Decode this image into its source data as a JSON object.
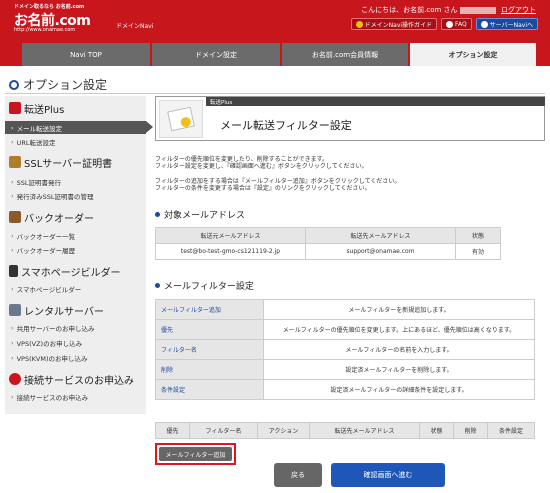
{
  "header": {
    "logo_small": "ドメイン取るなら お名前.com",
    "logo_text": "お名前.com",
    "logo_url": "http://www.onamae.com",
    "logo_navi": "ドメインNavi",
    "greeting_prefix": "こんにちは、お名前.com さん",
    "logout": "ログアウト",
    "links": [
      "ドメインNavi操作ガイド",
      "FAQ",
      "サーバーNaviへ"
    ]
  },
  "nav": {
    "tabs": [
      "Navi TOP",
      "ドメイン設定",
      "お名前.com会員情報",
      "オプション設定"
    ],
    "active_index": 3
  },
  "page_title": "オプション設定",
  "sidebar": {
    "sections": [
      {
        "title": "転送Plus",
        "icon": "arrow-icon",
        "items": [
          "メール転送設定",
          "URL転送設定"
        ]
      },
      {
        "title": "SSLサーバー証明書",
        "icon": "certificate-icon",
        "items": [
          "SSL証明書発行",
          "発行済みSSL証明書の管理"
        ]
      },
      {
        "title": "バックオーダー",
        "icon": "hammer-icon",
        "items": [
          "バックオーダー一覧",
          "バックオーダー履歴"
        ]
      },
      {
        "title": "スマホページビルダー",
        "icon": "smartphone-icon",
        "items": [
          "スマホページビルダー"
        ]
      },
      {
        "title": "レンタルサーバー",
        "icon": "server-icon",
        "items": [
          "共用サーバーのお申し込み",
          "VPS(VZ)のお申し込み",
          "VPS(KVM)のお申し込み"
        ]
      },
      {
        "title": "接続サービスのお申込み",
        "icon": "connection-icon",
        "items": [
          "接続サービスのお申込み"
        ]
      }
    ]
  },
  "banner": {
    "category": "転送Plus",
    "title": "メール転送フィルター設定"
  },
  "notes": {
    "line1": "フィルターの優先順位を変更したり、削除することができます。",
    "line2": "フィルター設定を変更し、『確認画面へ進む』ボタンをクリックしてください。",
    "line3": "フィルターの追加をする場合は『メールフィルター追加』ボタンをクリックしてください。",
    "line4": "フィルターの条件を変更する場合は『設定』のリンクをクリックしてください。"
  },
  "target_section": {
    "heading": "対象メールアドレス",
    "columns": [
      "転送元メールアドレス",
      "転送先メールアドレス",
      "状態"
    ],
    "rows": [
      [
        "test@bo-test-gmo-cs121119-2.jp",
        "support@onamae.com",
        "有効"
      ]
    ]
  },
  "filter_section": {
    "heading": "メールフィルター設定",
    "rows": [
      {
        "label": "メールフィルター追加",
        "desc": "メールフィルターを新規追加します。"
      },
      {
        "label": "優先",
        "desc": "メールフィルターの優先順位を変更します。上にあるほど、優先順位は高くなります。"
      },
      {
        "label": "フィルター名",
        "desc": "メールフィルターの名前を入力します。"
      },
      {
        "label": "削除",
        "desc": "設定済メールフィルターを削除します。"
      },
      {
        "label": "条件設定",
        "desc": "設定済メールフィルターの詳細条件を設定します。"
      }
    ]
  },
  "filter_list": {
    "columns": [
      "優先",
      "フィルター名",
      "アクション",
      "転送先メールアドレス",
      "状態",
      "削除",
      "条件設定"
    ]
  },
  "buttons": {
    "add_filter": "メールフィルター追加",
    "back": "戻る",
    "confirm": "確認画面へ進む"
  },
  "colors": {
    "brand_red": "#c8161d",
    "accent_blue": "#1f57b8",
    "highlight_red": "#e0161e"
  }
}
